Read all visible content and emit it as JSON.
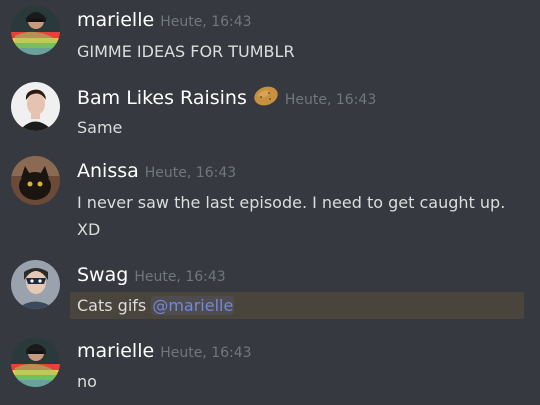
{
  "messages": [
    {
      "author": "marielle",
      "timestamp": "Heute, 16:43",
      "text": "GIMME IDEAS FOR TUMBLR",
      "avatar_icon": "rainbow-flag-avatar"
    },
    {
      "author": "Bam Likes Raisins",
      "timestamp": "Heute, 16:43",
      "text": "Same",
      "name_emoji": "potato-emoji",
      "avatar_icon": "portrait-avatar"
    },
    {
      "author": "Anissa",
      "timestamp": "Heute, 16:43",
      "text": "I never saw the last episode.  I need to get caught up.",
      "text_line2": "XD",
      "avatar_icon": "cat-avatar"
    },
    {
      "author": "Swag",
      "timestamp": "Heute, 16:43",
      "text": "Cats gifs ",
      "mention": "@marielle",
      "avatar_icon": "superhero-avatar"
    },
    {
      "author": "marielle",
      "timestamp": "Heute, 16:43",
      "text": "no",
      "avatar_icon": "rainbow-flag-avatar"
    }
  ],
  "colors": {
    "background": "#36393f",
    "username": "#ffffff",
    "timestamp": "#72767d",
    "message_text": "#dcddde",
    "mention": "#7289da",
    "mention_highlight": "#49443c"
  }
}
